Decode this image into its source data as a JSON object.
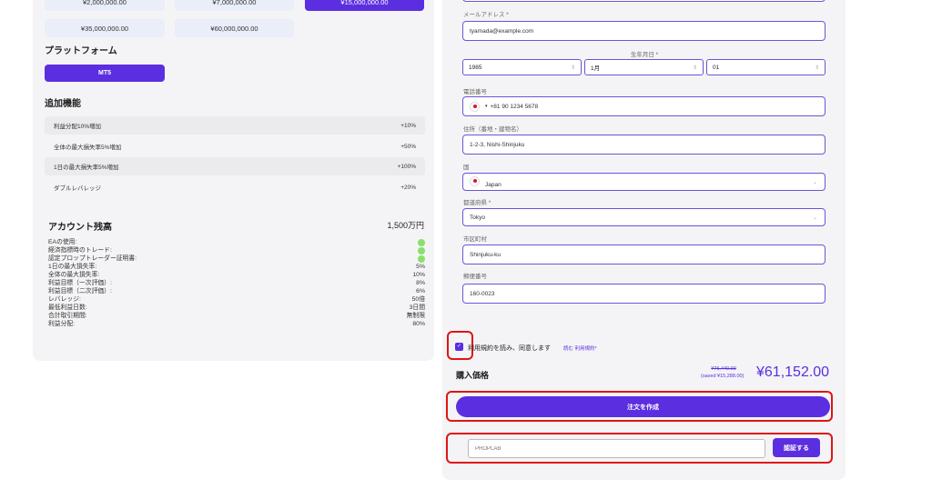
{
  "account_sizes": {
    "row1": [
      "¥2,000,000.00",
      "¥7,000,000.00",
      "¥15,000,000.00"
    ],
    "row2": [
      "¥35,000,000.00",
      "¥60,000,000.00"
    ]
  },
  "platform": {
    "title": "プラットフォーム",
    "selected": "MT5"
  },
  "addons": {
    "title": "追加機能",
    "items": [
      {
        "label": "利益分配10%増加",
        "value": "+10%"
      },
      {
        "label": "全体の最大損失率5%増加",
        "value": "+50%"
      },
      {
        "label": "1日の最大損失率5%増加",
        "value": "+100%"
      },
      {
        "label": "ダブルレバレッジ",
        "value": "+20%"
      }
    ]
  },
  "balance": {
    "title": "アカウント残高",
    "value": "1,500万円"
  },
  "specs": [
    {
      "label": "EAの使用:",
      "value": ""
    },
    {
      "label": "経済指標時のトレード:",
      "value": ""
    },
    {
      "label": "認定プロップトレーダー証明書:",
      "value": ""
    },
    {
      "label": "1日の最大損失率:",
      "value": "5%"
    },
    {
      "label": "全体の最大損失率:",
      "value": "10%"
    },
    {
      "label": "利益目標（一次評価）:",
      "value": "8%"
    },
    {
      "label": "利益目標（二次評価）:",
      "value": "6%"
    },
    {
      "label": "レバレッジ:",
      "value": "50倍"
    },
    {
      "label": "最低利益日数:",
      "value": "3日間"
    },
    {
      "label": "合計取引期間:",
      "value": "無制限"
    },
    {
      "label": "利益分配:",
      "value": "80%"
    }
  ],
  "form": {
    "email_label": "メールアドレス *",
    "email_value": "tyamada@example.com",
    "dob_label": "生年月日 *",
    "dob_year": "1985",
    "dob_month": "1月",
    "dob_day": "01",
    "phone_label": "電話番号",
    "phone_value": "+81 90 1234 5678",
    "address_label": "住所（番地・建物名）",
    "address_value": "1-2-3, Nishi-Shinjuku",
    "country_label": "国",
    "country_value": "Japan",
    "prefecture_label": "都道府県 *",
    "prefecture_value": "Tokyo",
    "city_label": "市区町村",
    "city_value": "Shinjuku-ku",
    "postal_label": "郵便番号",
    "postal_value": "160-0023"
  },
  "terms": {
    "text": "利用規約を読み、同意します",
    "link": "読む 利用規約*"
  },
  "price": {
    "label": "購入価格",
    "original": "¥76,440.00",
    "saved": "(saved ¥15,288.00)",
    "final": "¥61,152.00"
  },
  "order_button": "注文を作成",
  "coupon": {
    "placeholder": "PROPLAB",
    "button": "認証する"
  },
  "colors": {
    "accent": "#5b2ee0",
    "highlight": "#e01414",
    "check": "#8ae06a"
  }
}
